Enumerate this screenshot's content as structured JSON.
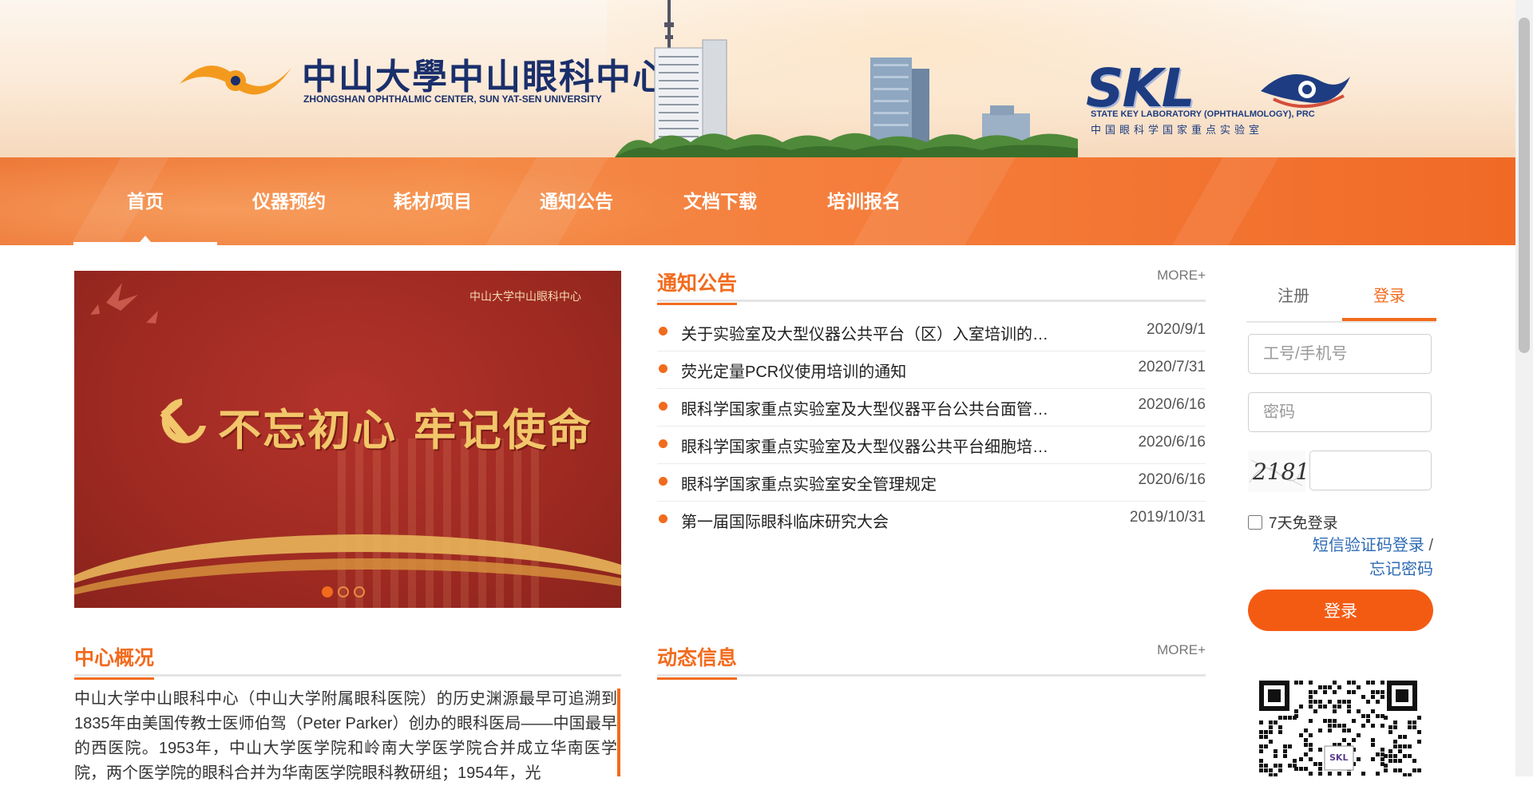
{
  "header": {
    "org_cn": "中山大學中山眼科中心",
    "org_en": "ZHONGSHAN OPHTHALMIC CENTER, SUN YAT-SEN UNIVERSITY",
    "skl_logo": "SKL",
    "skl_en": "STATE KEY LABORATORY (OPHTHALMOLOGY), PRC",
    "skl_cn": "中国眼科学国家重点实验室"
  },
  "nav": {
    "items": [
      {
        "label": "首页",
        "active": true
      },
      {
        "label": "仪器预约"
      },
      {
        "label": "耗材/项目"
      },
      {
        "label": "通知公告"
      },
      {
        "label": "文档下载"
      },
      {
        "label": "培训报名"
      }
    ]
  },
  "slider": {
    "slogan": "不忘初心 牢记使命",
    "mini_logo": "中山大学中山眼科中心",
    "slide_count": 3,
    "active_slide": 1
  },
  "notices": {
    "title": "通知公告",
    "more": "MORE+",
    "items": [
      {
        "title": "关于实验室及大型仪器公共平台（区）入室培训的…",
        "date": "2020/9/1"
      },
      {
        "title": "荧光定量PCR仪使用培训的通知",
        "date": "2020/7/31"
      },
      {
        "title": "眼科学国家重点实验室及大型仪器平台公共台面管…",
        "date": "2020/6/16"
      },
      {
        "title": "眼科学国家重点实验室及大型仪器公共平台细胞培…",
        "date": "2020/6/16"
      },
      {
        "title": "眼科学国家重点实验室安全管理规定",
        "date": "2020/6/16"
      },
      {
        "title": "第一届国际眼科临床研究大会",
        "date": "2019/10/31"
      }
    ]
  },
  "overview": {
    "title": "中心概况",
    "text": "中山大学中山眼科中心（中山大学附属眼科医院）的历史渊源最早可追溯到1835年由美国传教士医师伯驾（Peter Parker）创办的眼科医局——中国最早的西医院。1953年，中山大学医学院和岭南大学医学院合并成立华南医学院，两个医学院的眼科合并为华南医学院眼科教研组；1954年，光"
  },
  "news": {
    "title": "动态信息",
    "more": "MORE+"
  },
  "login": {
    "tab_register": "注册",
    "tab_login": "登录",
    "username_placeholder": "工号/手机号",
    "password_placeholder": "密码",
    "captcha_code": "2181",
    "remember_label": "7天免登录",
    "sms_login": "短信验证码登录",
    "separator": "/",
    "forgot_password": "忘记密码",
    "submit": "登录"
  },
  "colors": {
    "accent": "#f26b1d",
    "nav_bg": "#f48a47",
    "link": "#2e6bb5"
  }
}
